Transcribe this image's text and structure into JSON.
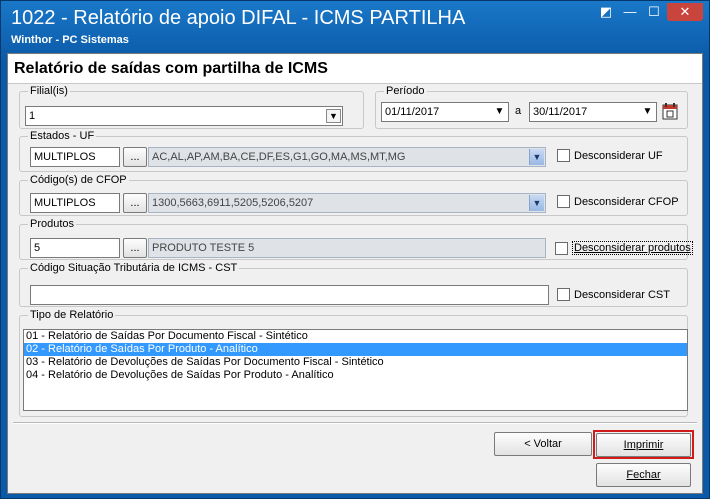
{
  "window": {
    "title": "1022 - Relatório de apoio DIFAL - ICMS PARTILHA",
    "subtitle": "Winthor - PC Sistemas",
    "controls": [
      "◩",
      "—",
      "☐",
      "✕"
    ]
  },
  "header": {
    "title": "Relatório de saídas com partilha de ICMS"
  },
  "filial": {
    "legend": "Filial(is)",
    "value": "1"
  },
  "periodo": {
    "legend": "Período",
    "start": "01/11/2017",
    "separator": "a",
    "end": "30/11/2017"
  },
  "estados": {
    "legend": "Estados - UF",
    "value": "MULTIPLOS",
    "browse": "...",
    "list": "AC,AL,AP,AM,BA,CE,DF,ES,G1,GO,MA,MS,MT,MG",
    "checkbox": "Desconsiderar UF"
  },
  "cfop": {
    "legend": "Código(s) de CFOP",
    "value": "MULTIPLOS",
    "browse": "...",
    "list": "1300,5663,6911,5205,5206,5207",
    "checkbox": "Desconsiderar CFOP"
  },
  "produtos": {
    "legend": "Produtos",
    "value": "5",
    "browse": "...",
    "description": "PRODUTO TESTE 5",
    "checkbox": "Desconsiderar produtos"
  },
  "cst": {
    "legend": "Código Situação Tributária de ICMS - CST",
    "value": "",
    "checkbox": "Desconsiderar CST"
  },
  "tipo_relatorio": {
    "legend": "Tipo de Relatório",
    "items": [
      "01 - Relatório de Saídas Por Documento Fiscal - Sintético",
      "02 - Relatório de Saídas Por Produto - Analítico",
      "03 - Relatório de Devoluções de Saídas Por Documento Fiscal - Sintético",
      "04 - Relatório de Devoluções de Saídas Por Produto - Analítico"
    ],
    "selected_index": 1
  },
  "buttons": {
    "voltar": "< Voltar",
    "imprimir": "Imprimir",
    "fechar": "Fechar"
  },
  "colors": {
    "highlight": "#d11a1a",
    "selection": "#3399ff"
  }
}
